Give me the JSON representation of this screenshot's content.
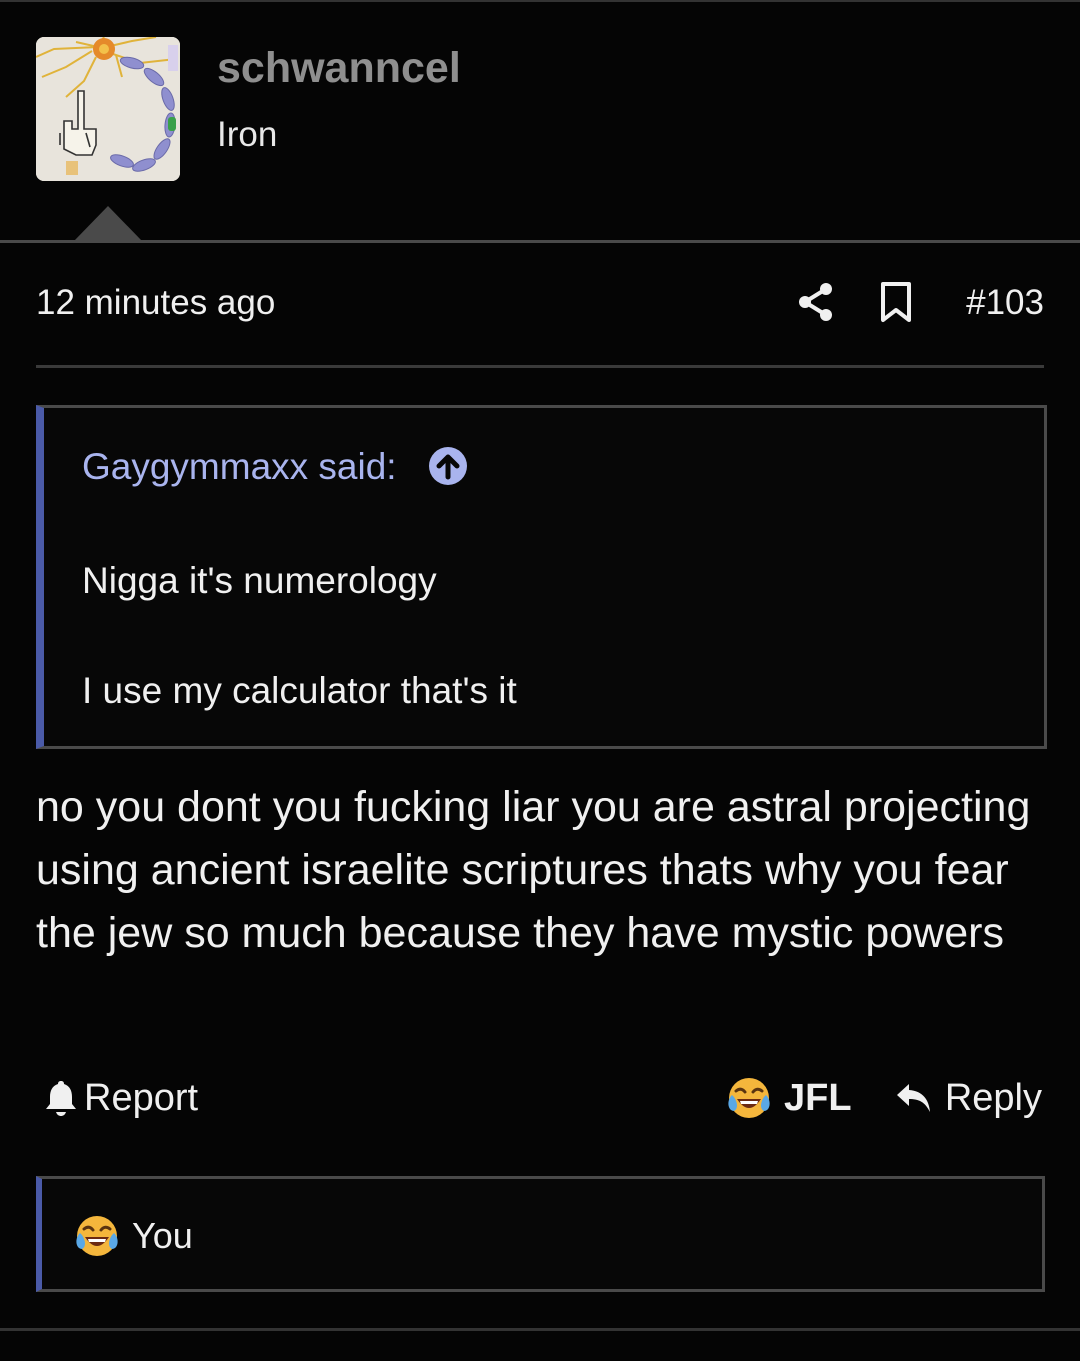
{
  "post": {
    "author": "schwanncel",
    "user_title": "Iron",
    "timestamp": "12 minutes ago",
    "post_number": "#103",
    "quote": {
      "author_label": "Gaygymmaxx said:",
      "lines": [
        "Nigga it's numerology",
        "I use my calculator that's it"
      ]
    },
    "body": "no you dont you fucking liar you are astral projecting using ancient israelite scriptures thats why you fear the jew so much because they have mystic powers"
  },
  "actions": {
    "report_label": "Report",
    "reaction_label": "JFL",
    "reply_label": "Reply"
  },
  "reactions": {
    "summary": "You"
  },
  "icons": {
    "share": "share-icon",
    "bookmark": "bookmark-icon",
    "quote_jump": "arrow-up-circle-icon",
    "report": "bell-icon",
    "reaction": "laughing-crying-emoji-icon",
    "reply": "reply-arrow-icon"
  },
  "colors": {
    "background": "#050505",
    "quote_author": "#a9b4ee",
    "quote_bar": "#4a5aa8",
    "username": "#8f8f8f",
    "divider": "#4a4a4a"
  }
}
